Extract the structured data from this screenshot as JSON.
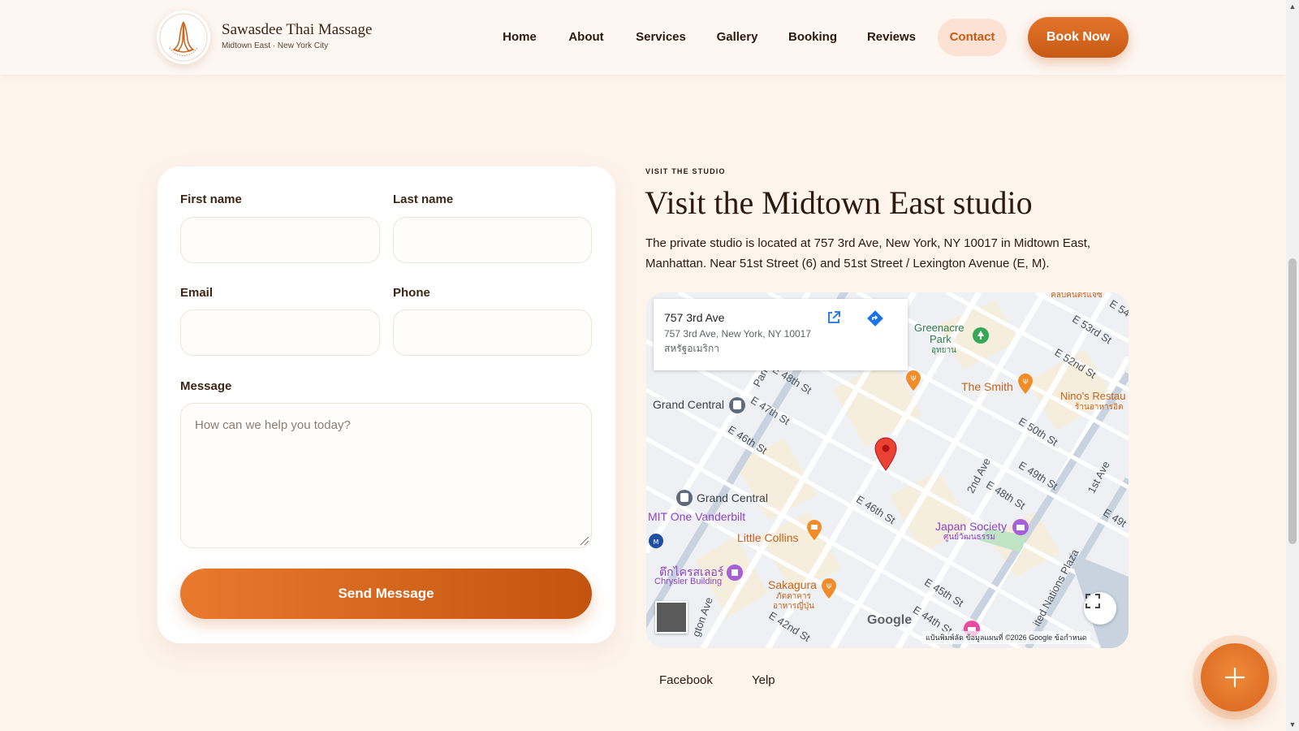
{
  "header": {
    "brand_name": "Sawasdee Thai Massage",
    "brand_sub": "Midtown East · New York City",
    "logo_text": "SAWASDEE THAI MASSAGE",
    "nav": [
      {
        "label": "Home"
      },
      {
        "label": "About"
      },
      {
        "label": "Services"
      },
      {
        "label": "Gallery"
      },
      {
        "label": "Booking"
      },
      {
        "label": "Reviews"
      },
      {
        "label": "Contact"
      }
    ],
    "active_nav": "Contact",
    "book_now_label": "Book Now"
  },
  "form": {
    "first_name_label": "First name",
    "last_name_label": "Last name",
    "email_label": "Email",
    "phone_label": "Phone",
    "message_label": "Message",
    "message_placeholder": "How can we help you today?",
    "send_label": "Send Message"
  },
  "visit": {
    "eyebrow": "VISIT THE STUDIO",
    "title": "Visit the Midtown East studio",
    "description": "The private studio is located at 757 3rd Ave, New York, NY 10017 in Midtown East, Manhattan. Near 51st Street (6) and 51st Street / Lexington Avenue (E, M)."
  },
  "map": {
    "place_title": "757 3rd Ave",
    "place_address": "757 3rd Ave, New York, NY 10017",
    "place_country": "สหรัฐอเมริกา",
    "labels": {
      "greenacre": "Greenacre",
      "park": "Park",
      "park_thai": "อุทยาน",
      "the_smith": "The Smith",
      "ninos": "Nino's Restau",
      "ninos_thai": "ร้านอาหารอิต",
      "grand_central_1": "Grand Central",
      "grand_central_2": "Grand Central",
      "mit_vanderbilt": "MIT One Vanderbilt",
      "little_collins": "Little Collins",
      "japan_society": "Japan Society",
      "japan_society_thai": "ศูนย์วัฒนธรรม",
      "chrysler_thai": "ตึกไครสเลอร์",
      "chrysler": "Chrysler Building",
      "sakagura": "Sakagura",
      "sakagura_thai_1": "ภัตตาคาร",
      "sakagura_thai_2": "อาหารญี่ปุ่น",
      "top_poi": "คลบคนตรแจซ",
      "streets": [
        "E 53rd St",
        "E 52nd St",
        "E 50th St",
        "E 49th St",
        "E 48th St",
        "E 48th St",
        "E 47th St",
        "E 46th St",
        "E 46th St",
        "E 45th St",
        "E 44th St",
        "E 42nd St",
        "E 54",
        "E 49t",
        "2nd Ave",
        "1st Ave",
        "Park",
        "gton Ave",
        "ited Nations Plaza"
      ]
    },
    "google": "Google",
    "attribution": "แป้นพิมพ์ลัด   ข้อมูลแผนที่ ©2026 Google   ข้อกำหนด"
  },
  "social": {
    "facebook": "Facebook",
    "yelp": "Yelp"
  },
  "colors": {
    "accent": "#d8641c",
    "accent_light": "#fbe2d2",
    "background": "#fdf4ec"
  }
}
